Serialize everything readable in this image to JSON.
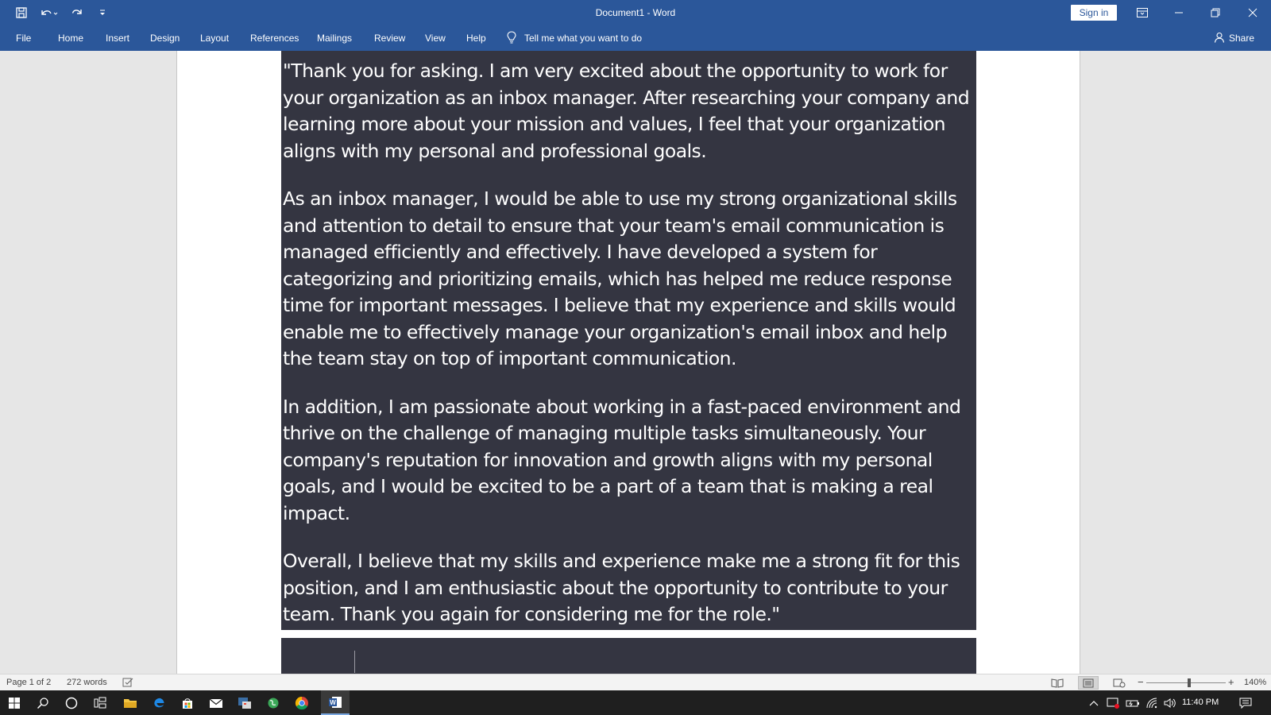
{
  "window": {
    "title": "Document1  -  Word",
    "sign_in": "Sign in"
  },
  "ribbon": {
    "tabs": [
      "File",
      "Home",
      "Insert",
      "Design",
      "Layout",
      "References",
      "Mailings",
      "Review",
      "View",
      "Help"
    ],
    "tell_me": "Tell me what you want to do",
    "share": "Share"
  },
  "document": {
    "paragraphs": [
      "\"Thank you for asking. I am very excited about the opportunity to work for your organization as an inbox manager. After researching your company and learning more about your mission and values, I feel that your organization aligns with my personal and professional goals.",
      "As an inbox manager, I would be able to use my strong organizational skills and attention to detail to ensure that your team's email communication is managed efficiently and effectively. I have developed a system for categorizing and prioritizing emails, which has helped me reduce response time for important messages. I believe that my experience and skills would enable me to effectively manage your organization's email inbox and help the team stay on top of important communication.",
      "In addition, I am passionate about working in a fast-paced environment and thrive on the challenge of managing multiple tasks simultaneously. Your company's reputation for innovation and growth aligns with my personal goals, and I would be excited to be a part of a team that is making a real impact.",
      "Overall, I believe that my skills and experience make me a strong fit for this position, and I am enthusiastic about the opportunity to contribute to your team. Thank you again for considering me for the role.\""
    ],
    "highlight_color": "#343541"
  },
  "statusbar": {
    "page": "Page 1 of 2",
    "words": "272 words",
    "zoom": "140%",
    "zoom_minus": "−",
    "zoom_plus": "+"
  },
  "taskbar": {
    "time": "11:40 PM"
  },
  "colors": {
    "accent": "#2b579a",
    "taskbar": "#1f1f1f"
  },
  "icons": [
    "save-icon",
    "undo-icon",
    "redo-icon",
    "customize-icon",
    "ribbon-display-icon",
    "minimize-icon",
    "restore-icon",
    "close-icon",
    "lightbulb-icon",
    "person-icon",
    "proofing-icon",
    "read-mode-icon",
    "print-layout-icon",
    "web-layout-icon",
    "windows-start-icon",
    "search-icon",
    "cortana-icon",
    "task-view-icon",
    "file-explorer-icon",
    "edge-icon",
    "store-icon",
    "mail-icon",
    "app-icon",
    "browser-icon",
    "chrome-icon",
    "word-icon",
    "chevron-up-icon",
    "defender-icon",
    "battery-icon",
    "wifi-icon",
    "volume-icon",
    "notifications-icon"
  ]
}
